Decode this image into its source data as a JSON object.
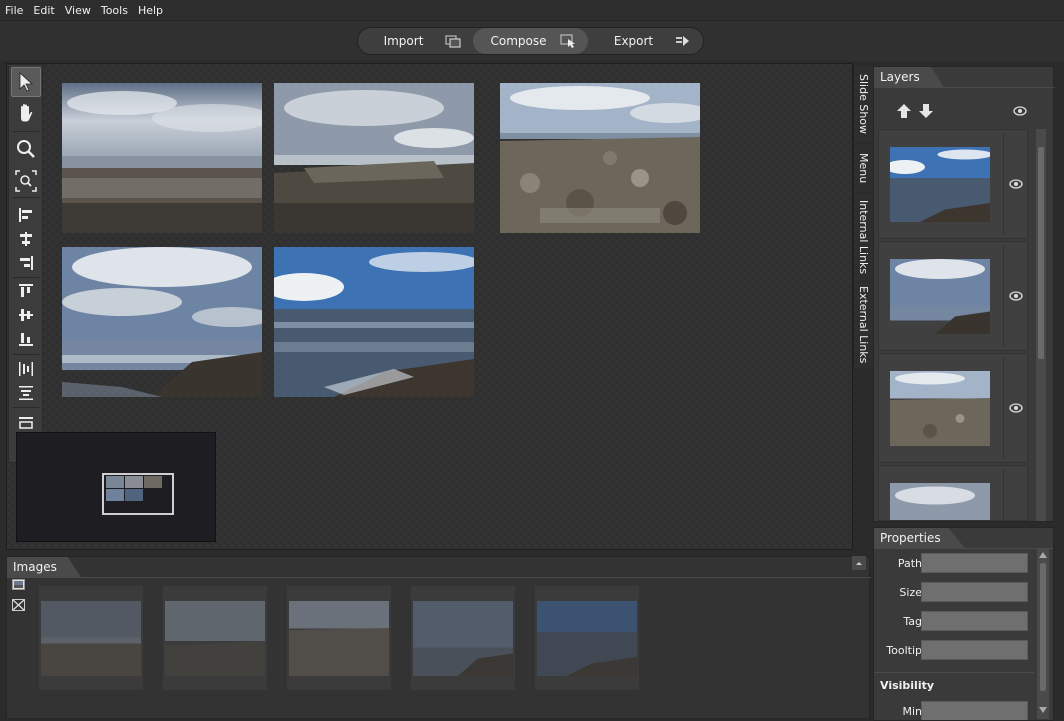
{
  "menu": [
    "File",
    "Edit",
    "View",
    "Tools",
    "Help"
  ],
  "modes": [
    {
      "label": "Import",
      "icon": "import-icon"
    },
    {
      "label": "Compose",
      "icon": "hand-pointer-icon",
      "active": true
    },
    {
      "label": "Export",
      "icon": "export-icon"
    }
  ],
  "tools": [
    {
      "name": "pointer-icon",
      "active": true
    },
    {
      "name": "hand-pan-icon"
    },
    {
      "name": "zoom-icon"
    },
    {
      "name": "zoom-fit-icon"
    },
    {
      "name": "align-left-icon"
    },
    {
      "name": "align-center-horizontal-icon"
    },
    {
      "name": "align-right-icon"
    },
    {
      "name": "align-top-icon"
    },
    {
      "name": "align-middle-vertical-icon"
    },
    {
      "name": "align-bottom-icon"
    },
    {
      "name": "distribute-horizontal-icon"
    },
    {
      "name": "distribute-vertical-icon"
    },
    {
      "name": "same-width-icon"
    },
    {
      "name": "same-height-icon"
    }
  ],
  "vertical_tabs": [
    "Slide Show",
    "Menu",
    "Internal Links",
    "External Links"
  ],
  "layers": {
    "title": "Layers",
    "move_up_icon": "arrow-up-icon",
    "move_down_icon": "arrow-down-icon",
    "visibility_icon": "eye-icon"
  },
  "properties": {
    "title": "Properties",
    "fields": [
      {
        "label": "Path",
        "value": ""
      },
      {
        "label": "Size",
        "value": ""
      },
      {
        "label": "Tag",
        "value": ""
      },
      {
        "label": "Tooltip",
        "value": ""
      }
    ],
    "section": "Visibility",
    "visibility_fields": [
      {
        "label": "Min",
        "value": ""
      }
    ]
  },
  "images_panel": {
    "title": "Images",
    "side_icons": [
      "add-image-icon",
      "remove-image-icon"
    ]
  },
  "colors": {
    "background": "#2b2b2b",
    "panel": "#3a3a3a",
    "accent_active": "#555555"
  }
}
